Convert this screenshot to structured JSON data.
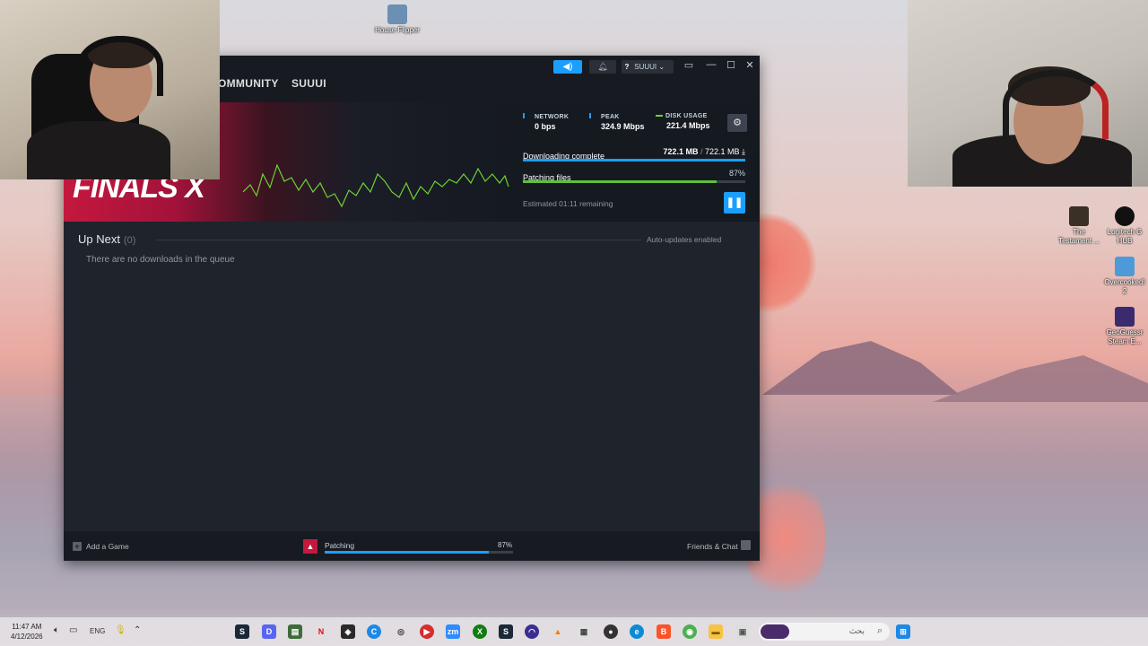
{
  "desktop": {
    "icons": [
      {
        "label": "House Flipper"
      },
      {
        "label": "The Testament ..."
      },
      {
        "label": "Logitech G HUB"
      },
      {
        "label": "Overcooked! 2"
      },
      {
        "label": "GeoGuessr Steam E..."
      }
    ]
  },
  "steam": {
    "nav": {
      "community": "OMMUNITY",
      "user": "SUUUI"
    },
    "account": {
      "name": "SUUUI ⌄",
      "help": "?"
    },
    "stats": {
      "network": {
        "label": "NETWORK",
        "value": "0 bps"
      },
      "peak": {
        "label": "PEAK",
        "value": "324.9 Mbps"
      },
      "disk": {
        "label": "DISK USAGE",
        "value": "221.4 Mbps"
      }
    },
    "download": {
      "status": "Downloading complete",
      "done": "722.1 MB",
      "sep": " / ",
      "total": "722.1 MB",
      "progress": 1.0
    },
    "patch": {
      "status": "Patching files",
      "percent": "87%",
      "progress": 0.87
    },
    "estimate": "Estimated 01:11 remaining",
    "hero_logo": "FINALS X",
    "queue": {
      "title": "Up Next",
      "count": "(0)",
      "auto_updates": "Auto-updates enabled",
      "empty": "There are no downloads in the queue"
    },
    "footer": {
      "add_game": "Add a Game",
      "game_status": "Patching",
      "game_percent": "87%",
      "game_progress": 0.87,
      "friends": "Friends & Chat"
    },
    "colors": {
      "accent": "#1a9fff",
      "patch_bar": "#5fbf3a",
      "brand": "#c4183f"
    }
  },
  "taskbar": {
    "time": "11:47 AM",
    "date": "4/12/2026",
    "lang": "ENG",
    "search_placeholder": "بحث"
  }
}
